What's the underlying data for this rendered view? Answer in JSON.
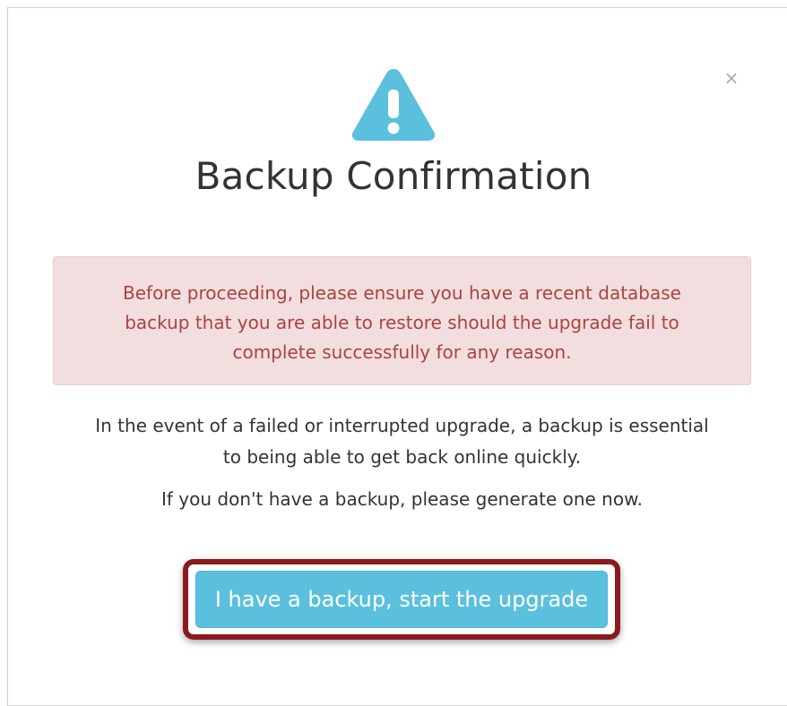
{
  "dialog": {
    "close_label": "×",
    "icon": "warning-triangle-icon",
    "icon_color": "#5bc0de",
    "title": "Backup Confirmation",
    "alert": {
      "text": "Before proceeding, please ensure you have a recent database backup that you are able to restore should the upgrade fail to complete successfully for any reason.",
      "background": "#f2dede",
      "text_color": "#a94442"
    },
    "info_paragraph_1": "In the event of a failed or interrupted upgrade, a backup is essential to being able to get back online quickly.",
    "info_paragraph_2": "If you don't have a backup, please generate one now.",
    "confirm_button": {
      "label": "I have a backup, start the upgrade",
      "color": "#5bc0de"
    },
    "highlight_color": "#8b1a1e"
  }
}
